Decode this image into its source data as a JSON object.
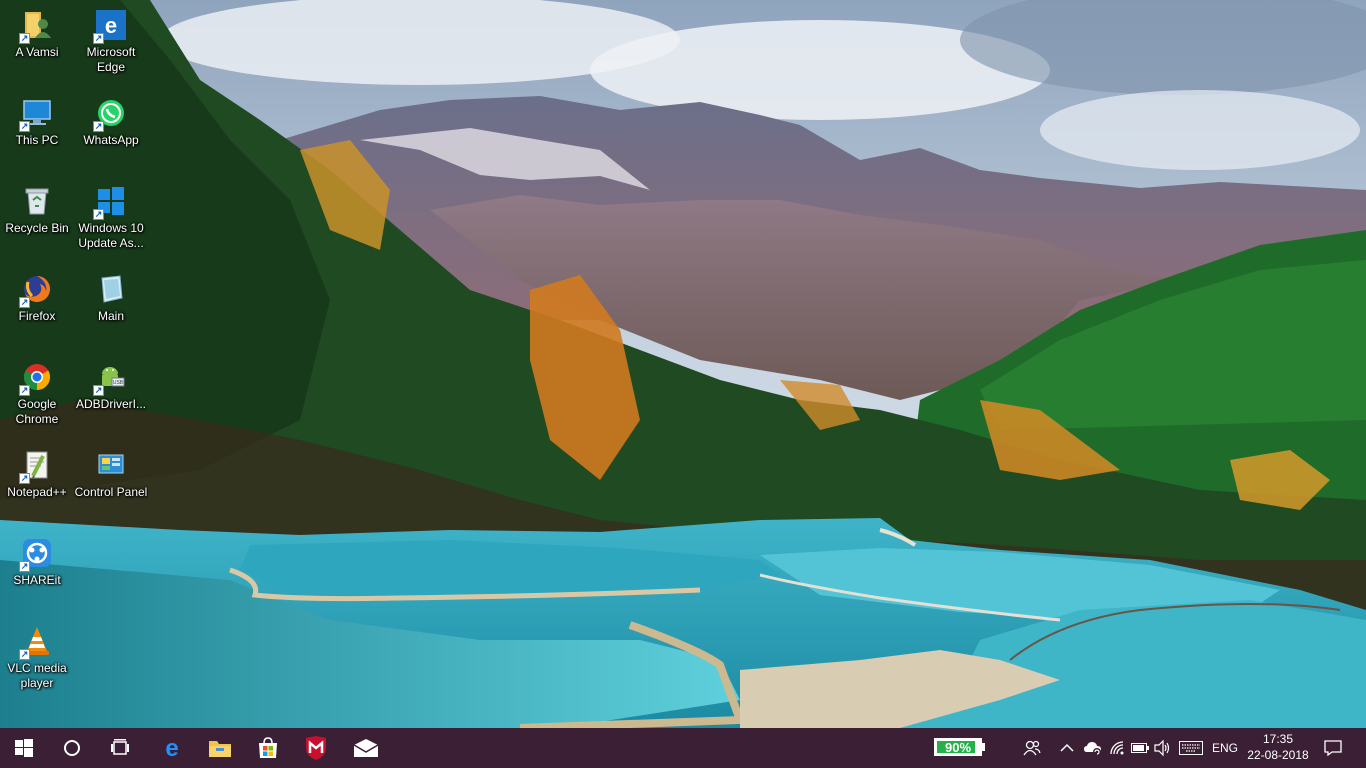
{
  "desktop": {
    "icons": [
      {
        "label": "A Vamsi",
        "icon": "user-folder-icon"
      },
      {
        "label": "Microsoft Edge",
        "icon": "edge-icon"
      },
      {
        "label": "This PC",
        "icon": "this-pc-icon"
      },
      {
        "label": "WhatsApp",
        "icon": "whatsapp-icon"
      },
      {
        "label": "Recycle Bin",
        "icon": "recycle-bin-icon"
      },
      {
        "label": "Windows 10 Update As...",
        "icon": "windows-update-icon"
      },
      {
        "label": "Firefox",
        "icon": "firefox-icon"
      },
      {
        "label": "Main",
        "icon": "document-icon"
      },
      {
        "label": "Google Chrome",
        "icon": "chrome-icon"
      },
      {
        "label": "ADBDriverI...",
        "icon": "android-driver-icon"
      },
      {
        "label": "Notepad++",
        "icon": "notepadpp-icon"
      },
      {
        "label": "Control Panel",
        "icon": "control-panel-icon"
      },
      {
        "label": "SHAREit",
        "icon": "shareit-icon"
      },
      {
        "label": "VLC media player",
        "icon": "vlc-icon"
      }
    ]
  },
  "taskbar": {
    "pinned": [
      {
        "name": "start",
        "icon": "windows-start-icon"
      },
      {
        "name": "search",
        "icon": "cortana-circle-icon"
      },
      {
        "name": "task-view",
        "icon": "task-view-icon"
      },
      {
        "name": "edge",
        "icon": "edge-icon"
      },
      {
        "name": "file-explorer",
        "icon": "folder-icon"
      },
      {
        "name": "store",
        "icon": "store-icon"
      },
      {
        "name": "mcafee",
        "icon": "mcafee-icon"
      },
      {
        "name": "mail",
        "icon": "mail-icon"
      }
    ],
    "battery": {
      "percent_text": "90%",
      "level": 0.9,
      "color": "#25b14a"
    },
    "tray_icons": [
      "people-icon",
      "chevron-up-icon",
      "onedrive-sync-icon",
      "wifi-icon",
      "battery-icon",
      "volume-icon",
      "keyboard-icon"
    ],
    "language": "ENG",
    "time": "17:35",
    "date": "22-08-2018",
    "notification_icon": "action-center-icon"
  },
  "colors": {
    "taskbar_bg": "#3a1f35",
    "accent": "#25b14a"
  }
}
